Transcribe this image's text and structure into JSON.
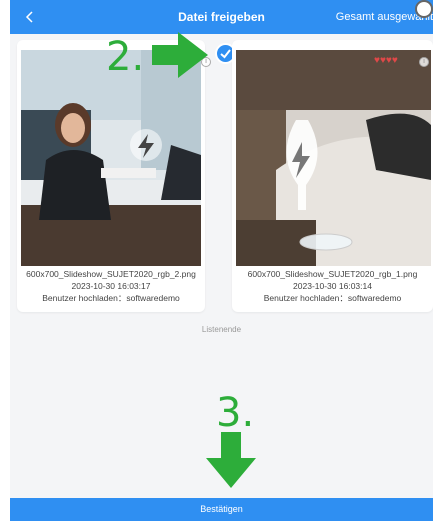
{
  "header": {
    "title": "Datei freigeben",
    "select_all": "Gesamt ausgewählt",
    "back_icon": "chevron-left-icon"
  },
  "files": [
    {
      "name": "600x700_Slideshow_SUJET2020_rgb_2.png",
      "date": "2023-10-30 16:03:17",
      "uploader": "Benutzer hochladen：softwaredemo",
      "selected": true
    },
    {
      "name": "600x700_Slideshow_SUJET2020_rgb_1.png",
      "date": "2023-10-30 16:03:14",
      "uploader": "Benutzer hochladen：softwaredemo",
      "selected": false,
      "rating": "♥♥♥♥"
    }
  ],
  "list_end": "Listenende",
  "annotations": {
    "step2": "2.",
    "step3": "3.",
    "arrow_color": "#2dad3a"
  },
  "footer": {
    "confirm_label": "Bestätigen"
  },
  "colors": {
    "primary": "#2f8ff2",
    "background": "#f4f5f7"
  }
}
